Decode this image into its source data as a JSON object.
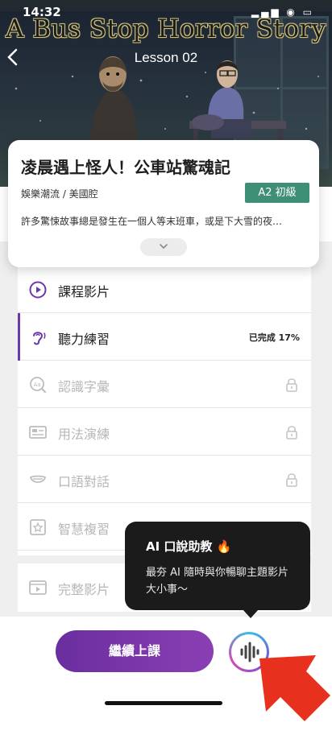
{
  "status_bar": {
    "time": "14:32"
  },
  "hero": {
    "title": "A Bus Stop Horror Story",
    "lesson_label": "Lesson 02"
  },
  "info_card": {
    "title": "凌晨遇上怪人！公車站驚魂記",
    "category": "娛樂潮流 / 美國腔",
    "level": "A2 初級",
    "description": "許多驚悚故事總是發生在一個人等末班車，或是下大雪的夜…"
  },
  "course_items": [
    {
      "label": "課程影片",
      "icon": "play-circle-icon",
      "locked": false,
      "active": false
    },
    {
      "label": "聽力練習",
      "icon": "ear-icon",
      "locked": false,
      "active": true,
      "progress": "已完成 17%"
    },
    {
      "label": "認識字彙",
      "icon": "vocabulary-search-icon",
      "locked": true,
      "active": false
    },
    {
      "label": "用法演練",
      "icon": "practice-card-icon",
      "locked": true,
      "active": false
    },
    {
      "label": "口語對話",
      "icon": "speaking-mouth-icon",
      "locked": true,
      "active": false
    },
    {
      "label": "智慧複習",
      "icon": "smart-review-icon",
      "locked": true,
      "active": false
    }
  ],
  "extra_item": {
    "label": "完整影片",
    "icon": "full-video-icon"
  },
  "tooltip": {
    "title": "AI 口說助教 🔥",
    "body": "最夯 AI 隨時與你暢聊主題影片大小事～"
  },
  "bottom": {
    "continue_label": "繼續上課"
  },
  "colors": {
    "accent_purple": "#6b3aa8",
    "level_green": "#3f8f77",
    "arrow_red": "#e8301e",
    "tooltip_bg": "#1b1b1b"
  }
}
